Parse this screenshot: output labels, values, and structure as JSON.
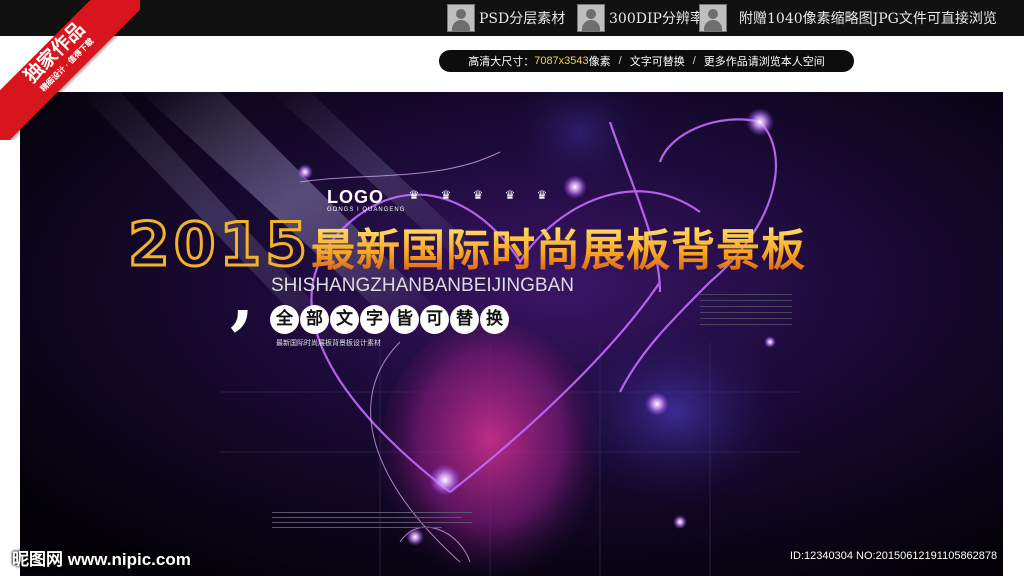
{
  "header": {
    "features": [
      {
        "icon": "user-avatar-icon",
        "label": "PSD分层素材"
      },
      {
        "icon": "user-avatar-icon",
        "label": "300DIP分辨率"
      },
      {
        "icon": "user-avatar-icon",
        "label": "附赠1040像素缩略图JPG文件可直接浏览"
      }
    ]
  },
  "info_bar": {
    "size_prefix": "高清大尺寸：",
    "size_value": "7087x3543",
    "size_suffix": "像素",
    "sep": "/",
    "text_replace": "文字可替换",
    "more": "更多作品请浏览本人空间"
  },
  "ribbon": {
    "main": "独家作品",
    "sub": "精细设计 · 值得下载"
  },
  "poster": {
    "logo": "LOGO",
    "logo_sub": "GONGS I QUANGENG",
    "crowns": [
      "♛",
      "♛",
      "♛",
      "♛",
      "♛"
    ],
    "year": "2015",
    "title": "最新国际时尚展板背景板",
    "pinyin": "SHISHANGZHANBANBEIJINGBAN",
    "comma": ",",
    "circle_chars": [
      "全",
      "部",
      "文",
      "字",
      "皆",
      "可",
      "替",
      "换"
    ],
    "description": "最新国际时尚展板背景板设计素材"
  },
  "watermark": {
    "site_cn": "昵图网",
    "site_url": "www.nipic.com",
    "id_text": "ID:12340304 NO:20150612191105862878"
  },
  "colors": {
    "accent_gold": "#f1b428",
    "ribbon_red": "#d8141c",
    "poster_bg": "#06030c",
    "neon_purple": "#b35cff"
  }
}
